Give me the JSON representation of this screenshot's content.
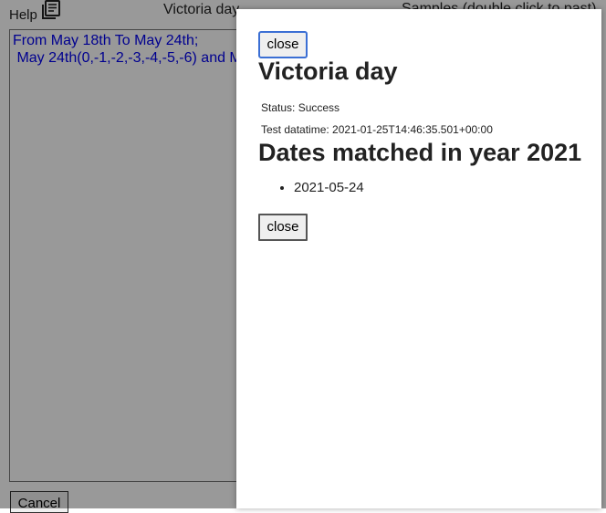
{
  "background": {
    "help_label": "Help",
    "help_icon": "book-icon",
    "top_title": "Victoria day",
    "samples_label": "Samples (double click to past)",
    "editor_lines": [
      "From May 18th To May 24th;",
      " May 24th(0,-1,-2,-3,-4,-5,-6) and Mo"
    ],
    "cancel_label": "Cancel"
  },
  "dialog": {
    "close_top_label": "close",
    "title": "Victoria day",
    "status_key": "Status:",
    "status_value": "Success",
    "datetime_key": "Test datatime:",
    "datetime_value": "2021-01-25T14:46:35.501+00:00",
    "matched_heading": "Dates matched in year 2021",
    "matched_dates": [
      "2021-05-24"
    ],
    "close_bottom_label": "close"
  },
  "colors": {
    "editor_text": "#0000ee",
    "focus_border": "#3b6fd4",
    "overlay": "rgba(0,0,0,0.40)"
  }
}
